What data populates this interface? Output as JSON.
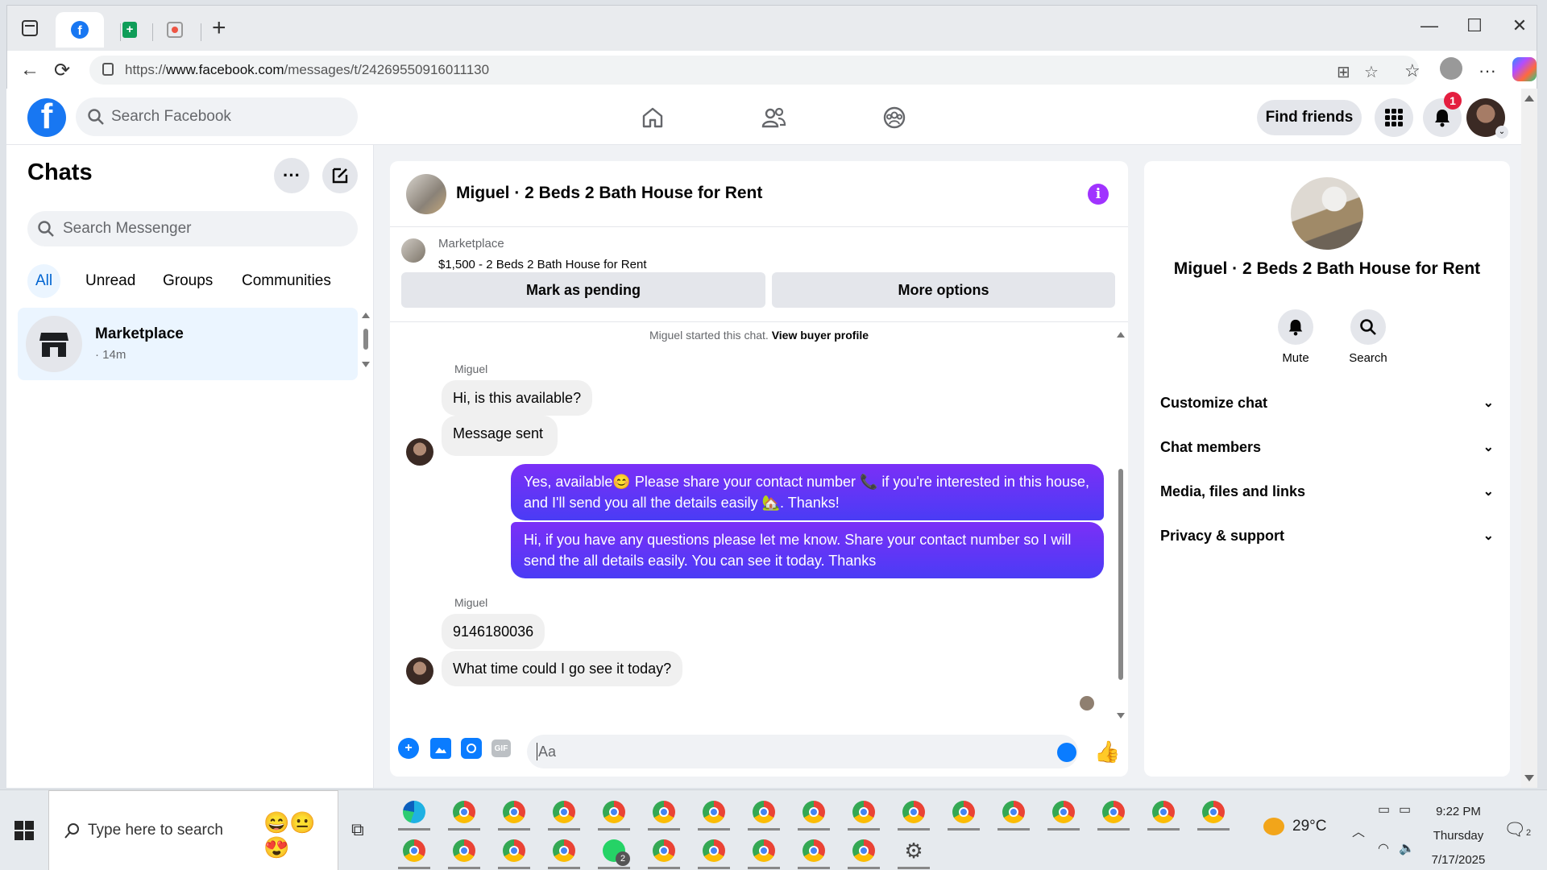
{
  "browser": {
    "url_prefix": "https://",
    "url_host": "www.facebook.com",
    "url_path": "/messages/t/24269550916011130"
  },
  "facebook": {
    "search_placeholder": "Search Facebook",
    "find_friends": "Find friends",
    "notification_count": "1"
  },
  "chats": {
    "title": "Chats",
    "search_placeholder": "Search Messenger",
    "filters": [
      "All",
      "Unread",
      "Groups",
      "Communities"
    ],
    "items": [
      {
        "name": "Marketplace",
        "time": "· 14m"
      }
    ]
  },
  "conversation": {
    "title": "Miguel · 2 Beds 2 Bath House for Rent",
    "marketplace_label": "Marketplace",
    "listing": "$1,500 - 2 Beds 2 Bath House for Rent",
    "mark_pending": "Mark as pending",
    "more_options": "More options",
    "system_text": "Miguel started this chat.",
    "system_link": "View buyer profile",
    "sender_name": "Miguel",
    "messages": [
      {
        "text": "Hi, is this available?"
      },
      {
        "text": "Message sent"
      },
      {
        "text": "Yes, available😊 Please share your contact number 📞 if you're interested in this house, and I'll send you all the details easily 🏡. Thanks!"
      },
      {
        "text": "Hi, if you have any questions please let me know. Share your contact number so I will send the all details easily. You can see it today. Thanks"
      },
      {
        "text": "9146180036"
      },
      {
        "text": "What time could I go see it today?"
      }
    ],
    "composer_placeholder": "Aa"
  },
  "details": {
    "name": "Miguel · 2 Beds 2 Bath House for Rent",
    "mute": "Mute",
    "search": "Search",
    "sections": [
      "Customize chat",
      "Chat members",
      "Media, files and links",
      "Privacy & support"
    ]
  },
  "taskbar": {
    "search_placeholder": "Type here to search",
    "temperature": "29°C",
    "time": "9:22 PM",
    "day": "Thursday",
    "date": "7/17/2025",
    "whatsapp_badge": "2",
    "notification_badge": "2"
  }
}
